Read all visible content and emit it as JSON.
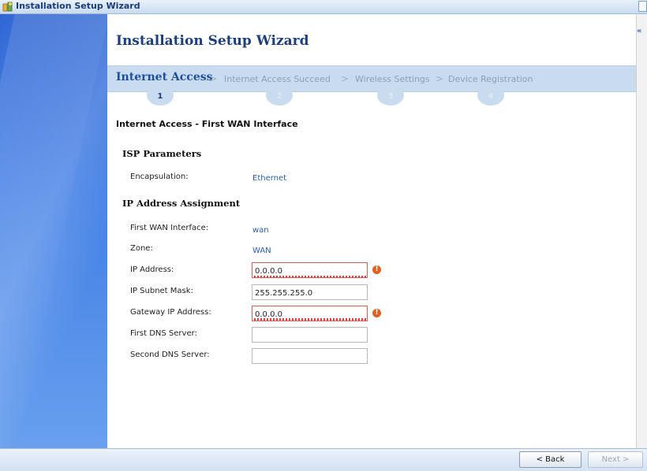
{
  "window": {
    "title": "Installation Setup Wizard"
  },
  "wizard": {
    "heading": "Installation Setup Wizard",
    "steps": [
      {
        "label": "Internet Access",
        "number": "1",
        "active": true
      },
      {
        "label": "Internet Access Succeed",
        "number": "2",
        "active": false
      },
      {
        "label": "Wireless Settings",
        "number": "3",
        "active": false
      },
      {
        "label": "Device Registration",
        "number": "4",
        "active": false
      }
    ],
    "separator": ">"
  },
  "form": {
    "section_title": "Internet Access - First WAN Interface",
    "isp": {
      "heading": "ISP Parameters",
      "encapsulation_label": "Encapsulation:",
      "encapsulation_value": "Ethernet"
    },
    "ip": {
      "heading": "IP Address Assignment",
      "first_wan_label": "First WAN Interface:",
      "first_wan_value": "wan",
      "zone_label": "Zone:",
      "zone_value": "WAN",
      "ip_address_label": "IP Address:",
      "ip_address_value": "0.0.0.0",
      "subnet_label": "IP Subnet Mask:",
      "subnet_value": "255.255.255.0",
      "gateway_label": "Gateway IP Address:",
      "gateway_value": "0.0.0.0",
      "dns1_label": "First DNS Server:",
      "dns1_value": "",
      "dns2_label": "Second DNS Server:",
      "dns2_value": ""
    },
    "error_icon": "!"
  },
  "footer": {
    "back_label": "< Back",
    "next_label": "Next >"
  },
  "colors": {
    "sidebar": "#3f7de5",
    "stepbar": "#c9dcef",
    "title": "#1c3f7d",
    "error": "#e05a5a"
  }
}
